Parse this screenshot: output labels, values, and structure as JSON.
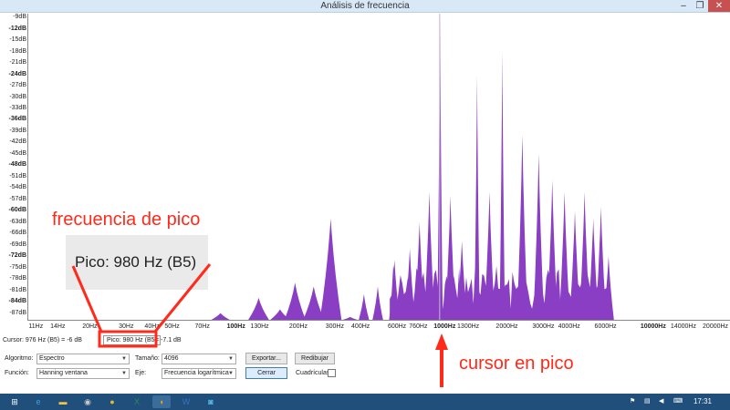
{
  "window": {
    "title": "Análisis de frecuencia",
    "min": "–",
    "max": "❐",
    "close": "✕"
  },
  "y_ticks": [
    {
      "label": "-9dB",
      "bold": false
    },
    {
      "label": "-12dB",
      "bold": true
    },
    {
      "label": "-15dB",
      "bold": false
    },
    {
      "label": "-18dB",
      "bold": false
    },
    {
      "label": "-21dB",
      "bold": false
    },
    {
      "label": "-24dB",
      "bold": true
    },
    {
      "label": "-27dB",
      "bold": false
    },
    {
      "label": "-30dB",
      "bold": false
    },
    {
      "label": "-33dB",
      "bold": false
    },
    {
      "label": "-36dB",
      "bold": true
    },
    {
      "label": "-39dB",
      "bold": false
    },
    {
      "label": "-42dB",
      "bold": false
    },
    {
      "label": "-45dB",
      "bold": false
    },
    {
      "label": "-48dB",
      "bold": true
    },
    {
      "label": "-51dB",
      "bold": false
    },
    {
      "label": "-54dB",
      "bold": false
    },
    {
      "label": "-57dB",
      "bold": false
    },
    {
      "label": "-60dB",
      "bold": true
    },
    {
      "label": "-63dB",
      "bold": false
    },
    {
      "label": "-66dB",
      "bold": false
    },
    {
      "label": "-69dB",
      "bold": false
    },
    {
      "label": "-72dB",
      "bold": true
    },
    {
      "label": "-75dB",
      "bold": false
    },
    {
      "label": "-78dB",
      "bold": false
    },
    {
      "label": "-81dB",
      "bold": false
    },
    {
      "label": "-84dB",
      "bold": true
    },
    {
      "label": "-87dB",
      "bold": false
    }
  ],
  "x_ticks": [
    {
      "label": "11Hz",
      "hz": 11,
      "bold": false
    },
    {
      "label": "14Hz",
      "hz": 14,
      "bold": false
    },
    {
      "label": "20Hz",
      "hz": 20,
      "bold": false
    },
    {
      "label": "30Hz",
      "hz": 30,
      "bold": false
    },
    {
      "label": "40Hz",
      "hz": 40,
      "bold": false
    },
    {
      "label": "50Hz",
      "hz": 50,
      "bold": false
    },
    {
      "label": "70Hz",
      "hz": 70,
      "bold": false
    },
    {
      "label": "100Hz",
      "hz": 100,
      "bold": true
    },
    {
      "label": "130Hz",
      "hz": 130,
      "bold": false
    },
    {
      "label": "200Hz",
      "hz": 200,
      "bold": false
    },
    {
      "label": "300Hz",
      "hz": 300,
      "bold": false
    },
    {
      "label": "400Hz",
      "hz": 400,
      "bold": false
    },
    {
      "label": "600Hz",
      "hz": 600,
      "bold": false
    },
    {
      "label": "760Hz",
      "hz": 760,
      "bold": false
    },
    {
      "label": "1000Hz",
      "hz": 1000,
      "bold": true
    },
    {
      "label": "1300Hz",
      "hz": 1300,
      "bold": false
    },
    {
      "label": "2000Hz",
      "hz": 2000,
      "bold": false
    },
    {
      "label": "3000Hz",
      "hz": 3000,
      "bold": false
    },
    {
      "label": "4000Hz",
      "hz": 4000,
      "bold": false
    },
    {
      "label": "6000Hz",
      "hz": 6000,
      "bold": false
    },
    {
      "label": "10000Hz",
      "hz": 10000,
      "bold": true
    },
    {
      "label": "14000Hz",
      "hz": 14000,
      "bold": false
    },
    {
      "label": "20000Hz",
      "hz": 20000,
      "bold": false
    }
  ],
  "chart_data": {
    "type": "area",
    "x_scale": "log",
    "xlim": [
      10,
      25000
    ],
    "ylim": [
      -89,
      -8
    ],
    "color": "#8a3ec4",
    "cursor_hz": 976,
    "peaks": [
      {
        "hz": 85,
        "db": -87
      },
      {
        "hz": 130,
        "db": -83
      },
      {
        "hz": 165,
        "db": -86
      },
      {
        "hz": 195,
        "db": -79
      },
      {
        "hz": 240,
        "db": -80
      },
      {
        "hz": 290,
        "db": -62
      },
      {
        "hz": 360,
        "db": -88
      },
      {
        "hz": 420,
        "db": -82
      },
      {
        "hz": 490,
        "db": -80
      },
      {
        "hz": 590,
        "db": -73
      },
      {
        "hz": 700,
        "db": -70
      },
      {
        "hz": 780,
        "db": -63
      },
      {
        "hz": 870,
        "db": -55
      },
      {
        "hz": 980,
        "db": -8
      },
      {
        "hz": 1100,
        "db": -56
      },
      {
        "hz": 1250,
        "db": -68
      },
      {
        "hz": 1480,
        "db": -24
      },
      {
        "hz": 1700,
        "db": -55
      },
      {
        "hz": 1960,
        "db": -18
      },
      {
        "hz": 2450,
        "db": -40
      },
      {
        "hz": 2940,
        "db": -45
      },
      {
        "hz": 3420,
        "db": -52
      },
      {
        "hz": 3920,
        "db": -55
      },
      {
        "hz": 4400,
        "db": -60
      },
      {
        "hz": 4900,
        "db": -55
      },
      {
        "hz": 5400,
        "db": -62
      },
      {
        "hz": 5880,
        "db": -59
      },
      {
        "hz": 6400,
        "db": -72
      }
    ]
  },
  "status": {
    "cursor": "Cursor: 976 Hz (B5) = -6 dB",
    "pico": "Pico: 980 Hz (B5)",
    "pico_db": "= -7.1 dB"
  },
  "controls": {
    "algoritmo_label": "Algoritmo:",
    "algoritmo_value": "Espectro",
    "tamano_label": "Tamaño:",
    "tamano_value": "4096",
    "funcion_label": "Función:",
    "funcion_value": "Hanning ventana",
    "eje_label": "Eje:",
    "eje_value": "Frecuencia logarítmica",
    "exportar": "Exportar...",
    "redibujar": "Redibujar",
    "cerrar": "Cerrar",
    "cuadriculas": "Cuadrículas"
  },
  "annotations": {
    "pico_zoom": "Pico: 980 Hz (B5)",
    "frecuencia_de_pico": "frecuencia de pico",
    "cursor_en_pico": "cursor en pico"
  },
  "taskbar": {
    "start": "⊞",
    "items": [
      {
        "name": "ie-icon",
        "glyph": "e",
        "color": "#3aa0e8"
      },
      {
        "name": "explorer-icon",
        "glyph": "▬",
        "color": "#f2c34b"
      },
      {
        "name": "app-icon",
        "glyph": "◉",
        "color": "#c9c9c9"
      },
      {
        "name": "chrome-icon",
        "glyph": "●",
        "color": "#e8b92c"
      },
      {
        "name": "excel-icon",
        "glyph": "X",
        "color": "#2e8b57"
      },
      {
        "name": "audacity-icon",
        "glyph": "◖",
        "color": "#f0a020"
      },
      {
        "name": "word-icon",
        "glyph": "W",
        "color": "#3d6fc5"
      },
      {
        "name": "app2-icon",
        "glyph": "◙",
        "color": "#57b7e8"
      }
    ],
    "clock": "17:31"
  }
}
